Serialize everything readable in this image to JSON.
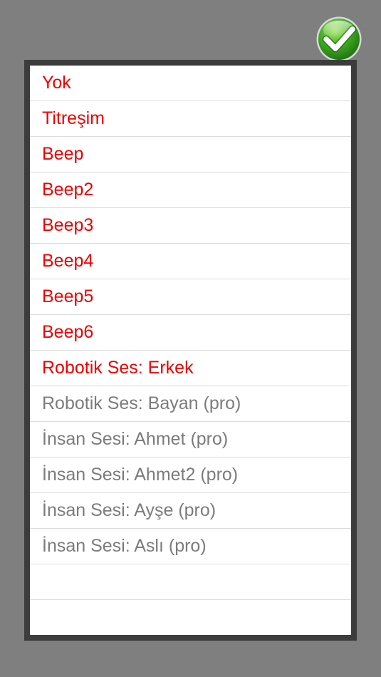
{
  "colors": {
    "background": "#7f7f7f",
    "frame": "#3c3c3c",
    "free_text": "#ee0000",
    "pro_text": "#7c7c7c",
    "confirm_green": "#3aa820"
  },
  "confirm": {
    "icon": "checkmark-icon"
  },
  "sounds": [
    {
      "label": "Yok",
      "pro": false
    },
    {
      "label": "Titreşim",
      "pro": false
    },
    {
      "label": "Beep",
      "pro": false
    },
    {
      "label": "Beep2",
      "pro": false
    },
    {
      "label": "Beep3",
      "pro": false
    },
    {
      "label": "Beep4",
      "pro": false
    },
    {
      "label": "Beep5",
      "pro": false
    },
    {
      "label": "Beep6",
      "pro": false
    },
    {
      "label": "Robotik Ses: Erkek",
      "pro": false
    },
    {
      "label": "Robotik Ses: Bayan (pro)",
      "pro": true
    },
    {
      "label": "İnsan Sesi: Ahmet (pro)",
      "pro": true
    },
    {
      "label": "İnsan Sesi: Ahmet2 (pro)",
      "pro": true
    },
    {
      "label": "İnsan Sesi: Ayşe (pro)",
      "pro": true
    },
    {
      "label": "İnsan Sesi: Aslı (pro)",
      "pro": true
    },
    {
      "label": "",
      "pro": false
    },
    {
      "label": "",
      "pro": false
    }
  ]
}
